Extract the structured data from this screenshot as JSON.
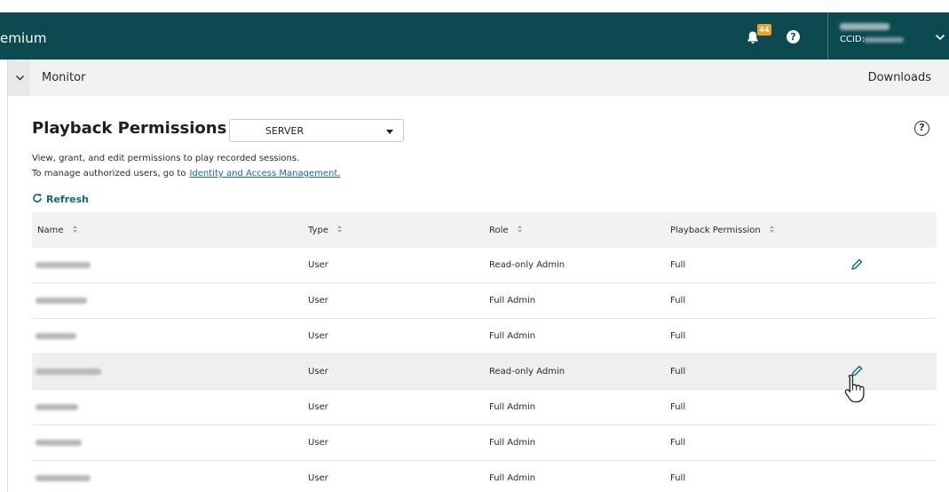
{
  "header": {
    "brand": "emium",
    "notifications_count": "44",
    "help_glyph": "?",
    "ccid_label": "CCID:"
  },
  "breadcrumb": {
    "current": "Monitor",
    "right_link": "Downloads"
  },
  "page": {
    "title": "Playback Permissions",
    "selector_value": "SERVER",
    "help_glyph": "?",
    "description_line1": "View, grant, and edit permissions to play recorded sessions.",
    "description_line2_prefix": "To manage authorized users, go to",
    "description_link": "Identity and Access Management.",
    "refresh_label": "Refresh"
  },
  "table": {
    "columns": [
      "Name",
      "Type",
      "Role",
      "Playback Permission"
    ],
    "rows": [
      {
        "type": "User",
        "role": "Read-only Admin",
        "permission": "Full",
        "editable": true
      },
      {
        "type": "User",
        "role": "Full Admin",
        "permission": "Full",
        "editable": false
      },
      {
        "type": "User",
        "role": "Full Admin",
        "permission": "Full",
        "editable": false
      },
      {
        "type": "User",
        "role": "Read-only Admin",
        "permission": "Full",
        "editable": true
      },
      {
        "type": "User",
        "role": "Full Admin",
        "permission": "Full",
        "editable": false
      },
      {
        "type": "User",
        "role": "Full Admin",
        "permission": "Full",
        "editable": false
      },
      {
        "type": "User",
        "role": "Full Admin",
        "permission": "Full",
        "editable": false
      }
    ]
  },
  "colors": {
    "topbar": "#0b4a4f",
    "accent": "#0b6a72",
    "link": "#1467b5",
    "badge": "#f0a023",
    "edit_icon": "#0b6a72"
  },
  "icons": {
    "notifications": "bell-icon",
    "help": "help-icon",
    "user_menu": "chevron-down-icon",
    "breadcrumb_toggle": "chevron-down-icon",
    "refresh": "refresh-icon",
    "sort": "sort-icon",
    "edit": "pencil-icon",
    "cursor": "hand-pointer-icon"
  }
}
